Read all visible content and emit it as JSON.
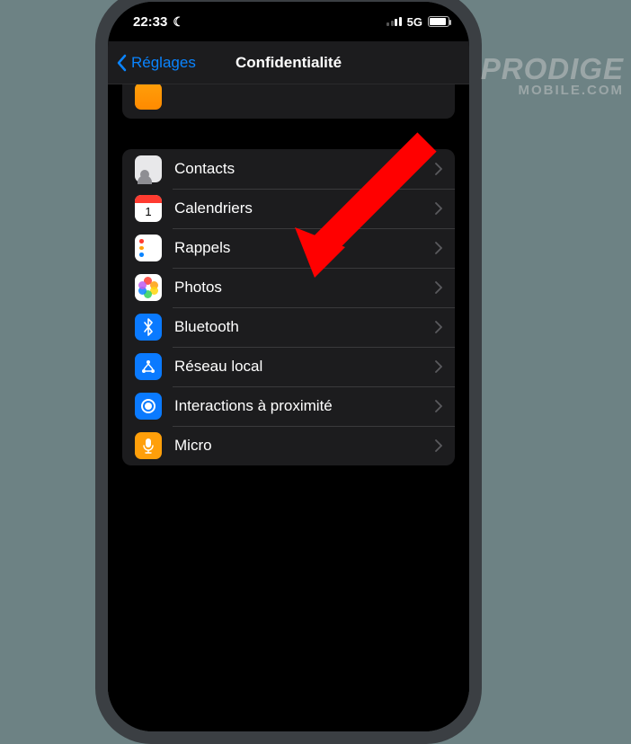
{
  "status": {
    "time": "22:33",
    "network": "5G"
  },
  "nav": {
    "back_label": "Réglages",
    "title": "Confidentialité"
  },
  "rows": {
    "contacts": "Contacts",
    "calendars": "Calendriers",
    "reminders": "Rappels",
    "photos": "Photos",
    "bluetooth": "Bluetooth",
    "local_network": "Réseau local",
    "nearby": "Interactions à proximité",
    "microphone": "Micro"
  },
  "watermark": {
    "line1": "PRODIGE",
    "line2": "MOBILE.COM"
  }
}
